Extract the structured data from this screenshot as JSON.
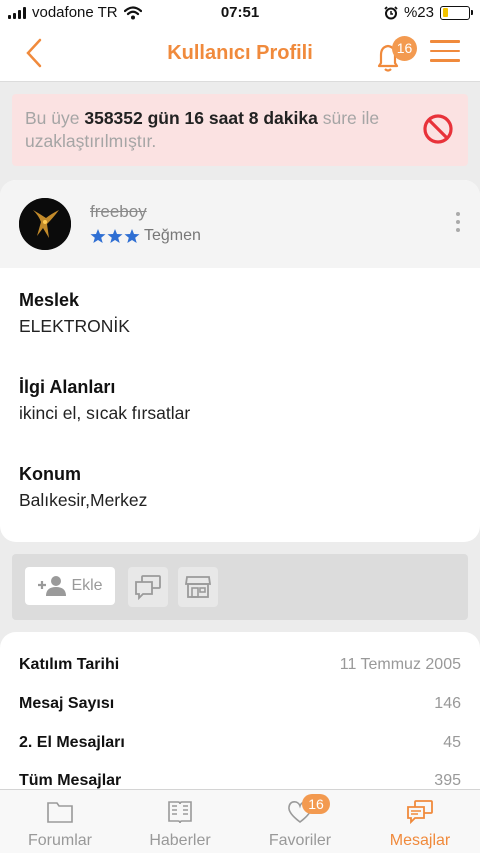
{
  "status_bar": {
    "carrier": "vodafone TR",
    "time": "07:51",
    "battery_text": "%23",
    "battery_level": 0.23
  },
  "nav": {
    "title": "Kullanıcı Profili",
    "notification_count": "16",
    "icons": {
      "back": "back-chevron-icon",
      "notifications": "bell-icon",
      "menu": "hamburger-menu-icon"
    },
    "accent_color": "#f08a3c"
  },
  "ban_notice": {
    "prefix": "Bu üye ",
    "duration": "358352 gün 16 saat 8 dakika",
    "suffix": " süre ile uzaklaştırılmıştır.",
    "icon": "prohibited-icon",
    "color": "#e8323a"
  },
  "profile": {
    "username": "freeboy",
    "rank_stars": 3,
    "rank": "Teğmen",
    "fields": [
      {
        "label": "Meslek",
        "value": "ELEKTRONİK"
      },
      {
        "label": "İlgi Alanları",
        "value": "ikinci el, sıcak fırsatlar"
      },
      {
        "label": "Konum",
        "value": "Balıkesir,Merkez"
      }
    ]
  },
  "actions": {
    "add_label": "Ekle",
    "icons": [
      "add-friend-icon",
      "message-icon",
      "store-icon"
    ]
  },
  "stats": [
    {
      "label": "Katılım Tarihi",
      "value": "11 Temmuz 2005"
    },
    {
      "label": "Mesaj Sayısı",
      "value": "146"
    },
    {
      "label": "2. El Mesajları",
      "value": "45"
    },
    {
      "label": "Tüm Mesajlar",
      "value": "395"
    }
  ],
  "tabs": [
    {
      "label": "Forumlar",
      "icon": "folder-icon",
      "active": false
    },
    {
      "label": "Haberler",
      "icon": "newspaper-icon",
      "active": false
    },
    {
      "label": "Favoriler",
      "icon": "heart-icon",
      "active": false,
      "badge": "16"
    },
    {
      "label": "Mesajlar",
      "icon": "chat-bubbles-icon",
      "active": true
    }
  ]
}
